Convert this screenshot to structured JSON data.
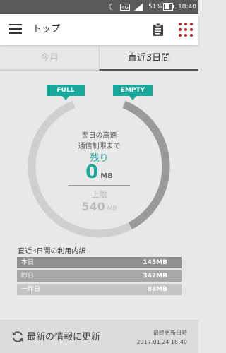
{
  "status_bar": {
    "network": "4G",
    "battery": "51%",
    "time": "18:40"
  },
  "header": {
    "title": "トップ",
    "icons": [
      "menu-icon",
      "clipboard-icon",
      "grid-menu-icon"
    ]
  },
  "tabs": [
    {
      "label": "今月",
      "active": false
    },
    {
      "label": "直近3日間",
      "active": true
    }
  ],
  "gauge": {
    "flag_full": "FULL",
    "flag_empty": "EMPTY",
    "label_line1": "翌日の高速",
    "label_line2": "通信制限まで",
    "remaining_label": "残り",
    "remaining_value": "0",
    "remaining_unit": "MB",
    "limit_label": "上限",
    "limit_value": "540",
    "limit_unit": "MB",
    "used_fraction": 1.0,
    "colors": {
      "accent": "#1aa89a",
      "ring_dark": "#9a9a9a",
      "ring_light": "#cfcfcf"
    }
  },
  "usage": {
    "title": "直近3日間の利用内訳",
    "rows": [
      {
        "label": "本日",
        "value": "145MB"
      },
      {
        "label": "昨日",
        "value": "342MB"
      },
      {
        "label": "一昨日",
        "value": "88MB"
      }
    ]
  },
  "footer": {
    "refresh_label": "最新の情報に更新",
    "last_update_label": "最終更新日時",
    "last_update_value": "2017.01.24 18:40"
  }
}
